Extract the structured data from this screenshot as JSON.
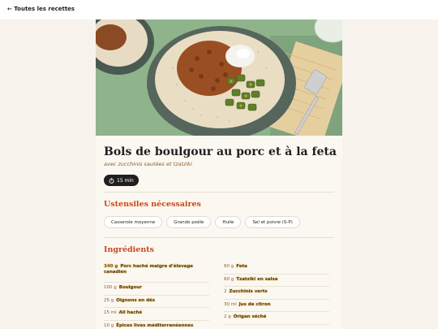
{
  "nav": {
    "back_label": "← Toutes les recettes"
  },
  "recipe": {
    "title": "Bols de boulgour au porc et à la feta",
    "subtitle": "avec zucchinis sautées et tzatziki",
    "time": "15 min",
    "time_icon": "stopwatch-icon"
  },
  "utensils": {
    "heading": "Ustensiles nécessaires",
    "items": [
      "Casserole moyenne",
      "Grande poêle",
      "Huile",
      "Sel et poivre (S-P)"
    ]
  },
  "ingredients": {
    "heading": "Ingrédients",
    "left": [
      {
        "qty": "340 g",
        "name": "Porc haché maigre d'élevage canadien"
      },
      {
        "qty": "100 g",
        "name": "Boulgour"
      },
      {
        "qty": "25 g",
        "name": "Oignons en dés"
      },
      {
        "qty": "15 ml",
        "name": "Ail haché"
      },
      {
        "qty": "10 g",
        "name": "Épices lives méditerranéennes"
      }
    ],
    "right": [
      {
        "qty": "60 g",
        "name": "Feta"
      },
      {
        "qty": "60 g",
        "name": "Tzatziki en salsa"
      },
      {
        "qty": "2",
        "name": "Zucchinis verts"
      },
      {
        "qty": "30 ml",
        "name": "Jus de citron"
      },
      {
        "qty": "2 g",
        "name": "Origan séché"
      }
    ]
  },
  "colors": {
    "accent": "#c8481d",
    "page_bg": "#f7f3ec",
    "pill_bg": "#1f1f1f"
  }
}
